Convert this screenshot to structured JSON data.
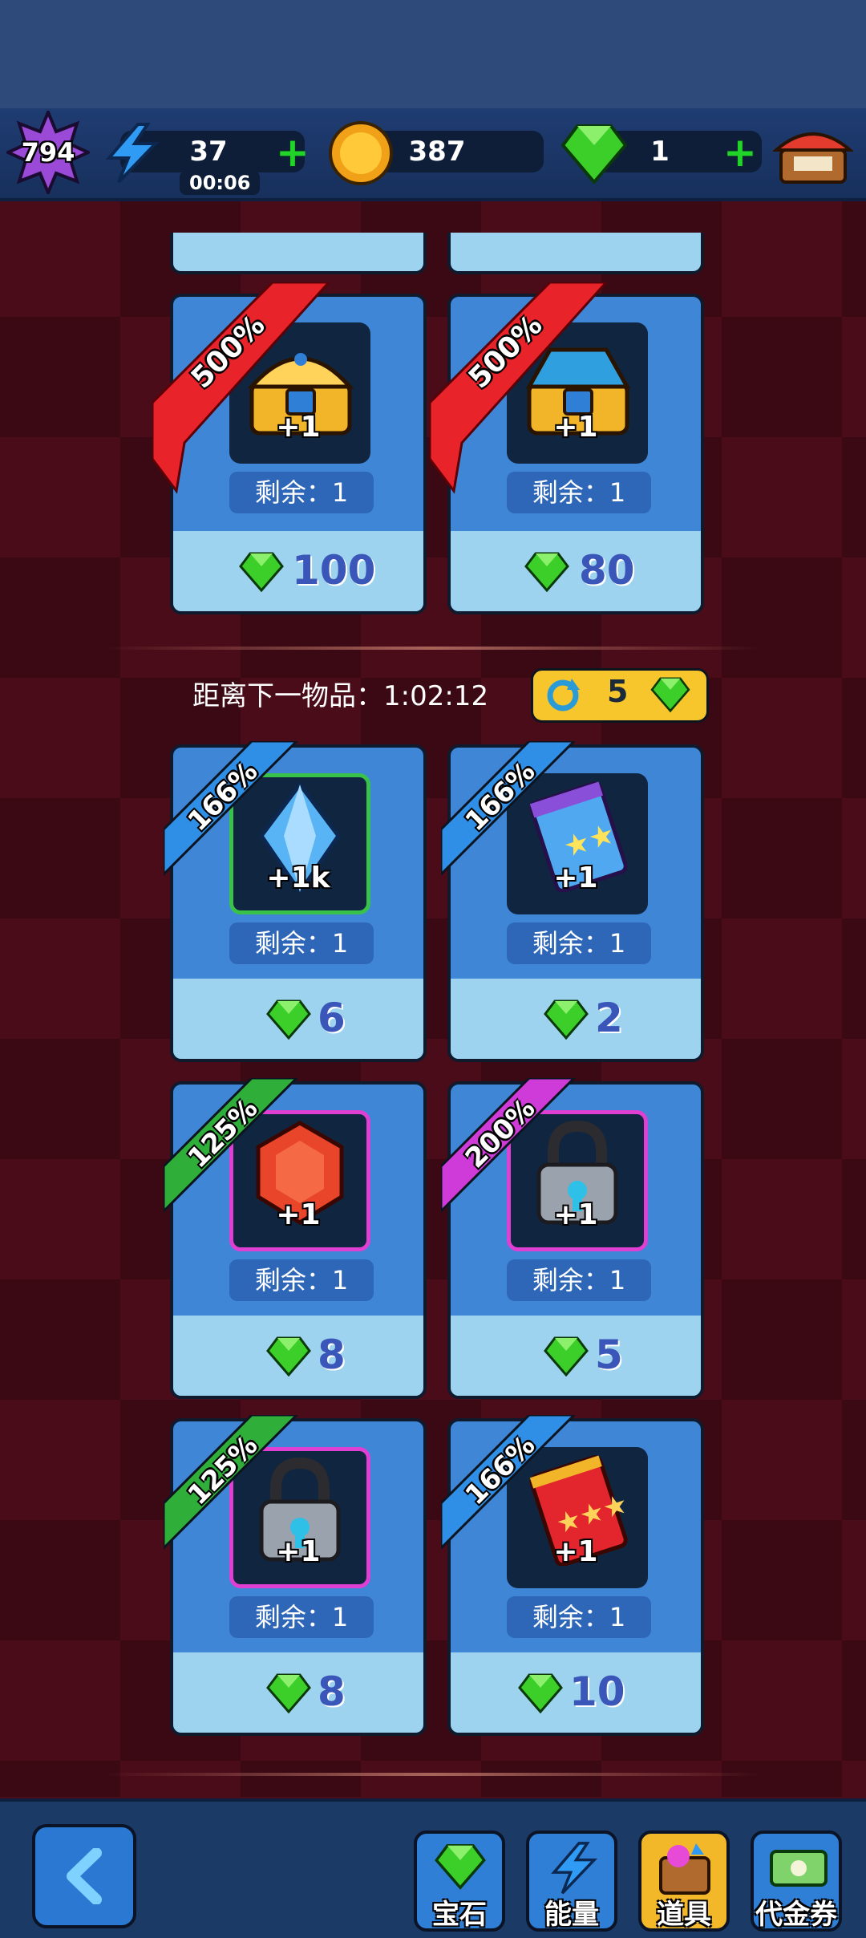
{
  "hud": {
    "level": "794",
    "energy": "37",
    "energy_timer": "00:06",
    "coins": "387",
    "gems": "1"
  },
  "offers_top": [
    {
      "discount": "500%",
      "qty": "+1",
      "remain": "剩余：1",
      "price": "100",
      "item": "golden-chest-icon"
    },
    {
      "discount": "500%",
      "qty": "+1",
      "remain": "剩余：1",
      "price": "80",
      "item": "blue-chest-icon"
    }
  ],
  "next_item": {
    "label": "距离下一物品：",
    "time": "1:02:12"
  },
  "refresh": {
    "cost": "5"
  },
  "offers": [
    {
      "discount": "166%",
      "qty": "+1k",
      "remain": "剩余：1",
      "price": "6",
      "item": "crystal-icon",
      "ribbon_color": "#2f8fe6",
      "frame": "#38c24a"
    },
    {
      "discount": "166%",
      "qty": "+1",
      "remain": "剩余：1",
      "price": "2",
      "item": "blue-card-pack-icon",
      "ribbon_color": "#2f8fe6",
      "frame": ""
    },
    {
      "discount": "125%",
      "qty": "+1",
      "remain": "剩余：1",
      "price": "8",
      "item": "red-gem-icon",
      "ribbon_color": "#2fae3a",
      "frame": "#e03fd3"
    },
    {
      "discount": "200%",
      "qty": "+1",
      "remain": "剩余：1",
      "price": "5",
      "item": "padlock-icon",
      "ribbon_color": "#cf3bd8",
      "frame": "#e03fd3"
    },
    {
      "discount": "125%",
      "qty": "+1",
      "remain": "剩余：1",
      "price": "8",
      "item": "padlock-icon",
      "ribbon_color": "#2fae3a",
      "frame": "#e03fd3"
    },
    {
      "discount": "166%",
      "qty": "+1",
      "remain": "剩余：1",
      "price": "10",
      "item": "red-card-pack-icon",
      "ribbon_color": "#2f8fe6",
      "frame": ""
    }
  ],
  "nav": {
    "gem_label": "宝石",
    "energy_label": "能量",
    "items_label": "道具",
    "voucher_label": "代金券"
  },
  "colors": {
    "accent": "#3f86d6",
    "price_bar": "#9dd3ee",
    "gem": "#3ccf2a"
  }
}
